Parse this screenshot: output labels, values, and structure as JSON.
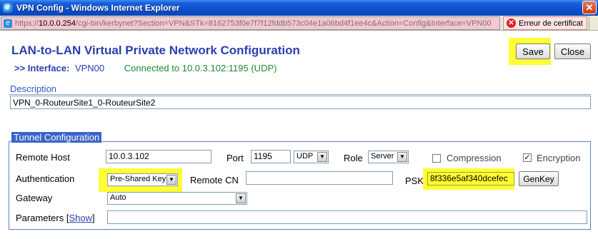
{
  "window": {
    "title": "VPN Config - Windows Internet Explorer",
    "close_glyph": "✕"
  },
  "address_bar": {
    "url_proto": "https://",
    "url_host": "10.0.0.254",
    "url_rest": "/cgi-bin/kerbynet?Section=VPN&STk=8162753f0e7f7f12fddb573c04e1a06bd4f1ee4c&Action=Config&Interface=VPN00",
    "cert_error": "Erreur de certificat",
    "ie_glyph": "e",
    "cert_glyph": "✕"
  },
  "page": {
    "title": "LAN-to-LAN Virtual Private Network Configuration",
    "interface_prefix": ">> Interface:",
    "interface_name": "VPN00",
    "status": "Connected to 10.0.3.102:1195 (UDP)"
  },
  "toolbar": {
    "save_label": "Save",
    "close_label": "Close"
  },
  "description": {
    "label": "Description",
    "value": "VPN_0-RouteurSite1_0-RouteurSite2"
  },
  "tunnel": {
    "section_label": "Tunnel Configuration",
    "remote_host_label": "Remote Host",
    "remote_host_value": "10.0.3.102",
    "port_label": "Port",
    "port_value": "1195",
    "protocol_value": "UDP",
    "role_label": "Role",
    "role_value": "Server",
    "compression_label": "Compression",
    "compression_checked": false,
    "encryption_label": "Encryption",
    "encryption_checked": true,
    "encryption_mark": "✓",
    "authentication_label": "Authentication",
    "authentication_value": "Pre-Shared Key",
    "remote_cn_label": "Remote CN",
    "remote_cn_value": "",
    "psk_label": "PSK",
    "psk_value": "8f336e5af340dcefec",
    "genkey_label": "GenKey",
    "gateway_label": "Gateway",
    "gateway_value": "Auto",
    "parameters_label": "Parameters",
    "parameters_bracket_open": "[",
    "parameters_link": "Show",
    "parameters_bracket_close": "]",
    "parameters_value": "",
    "dropdown_glyph": "▼"
  },
  "colors": {
    "highlight": "#ffff33",
    "title_blue": "#2a3fae",
    "status_green": "#1d8a2e",
    "section_blue": "#3a64c7",
    "address_error_pink": "#f7c6cf"
  }
}
